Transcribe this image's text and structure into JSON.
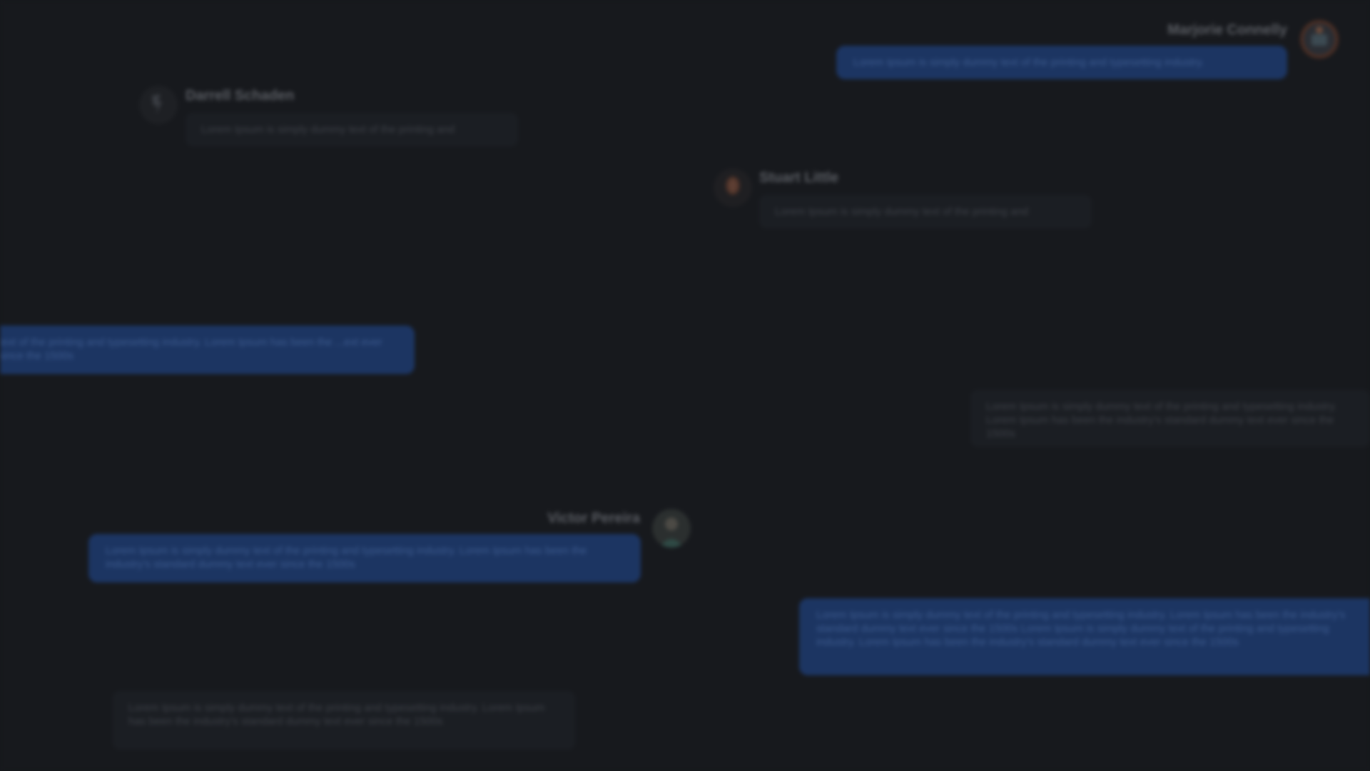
{
  "messages": [
    {
      "author": "Marjorie Connelly",
      "text": "Lorem Ipsum is simply dummy text of the printing and typesetting industry."
    },
    {
      "author": "Darrell Schaden",
      "text": "Lorem Ipsum is simply dummy text of the printing and"
    },
    {
      "author": "Stuart Little",
      "text": "Lorem Ipsum is simply dummy text of the printing and"
    },
    {
      "author": "",
      "text": "text of the printing and typesetting industry. Lorem Ipsum has been the ...ext ever since the 1500s"
    },
    {
      "author": "",
      "text": "Lorem Ipsum is simply dummy text of the printing and typesetting industry. Lorem Ipsum has been the industry's standard dummy text ever since the 1500s"
    },
    {
      "author": "Victor Pereira",
      "text": "Lorem Ipsum is simply dummy text of the printing and typesetting industry. Lorem Ipsum has been the industry's standard dummy text ever since the 1500s"
    },
    {
      "author": "",
      "text": "Lorem Ipsum is simply dummy text of the printing and typesetting industry. Lorem Ipsum has been the industry's standard dummy text ever since the 1500s Lorem Ipsum is simply dummy text of the printing and typesetting industry. Lorem Ipsum has been the industry's standard dummy text ever since the 1500s"
    },
    {
      "author": "",
      "text": "Lorem Ipsum is simply dummy text of the printing and typesetting industry. Lorem Ipsum has been the industry's standard dummy text ever since the 1500s"
    }
  ],
  "colors": {
    "background": "#17191d",
    "outgoing_bubble": "#1c3562",
    "incoming_bubble": "#1b1e23"
  },
  "icons": {
    "avatar_marjorie": "user-avatar-icon",
    "avatar_darrell": "user-avatar-icon",
    "avatar_stuart": "user-avatar-icon",
    "avatar_victor": "user-avatar-icon"
  }
}
